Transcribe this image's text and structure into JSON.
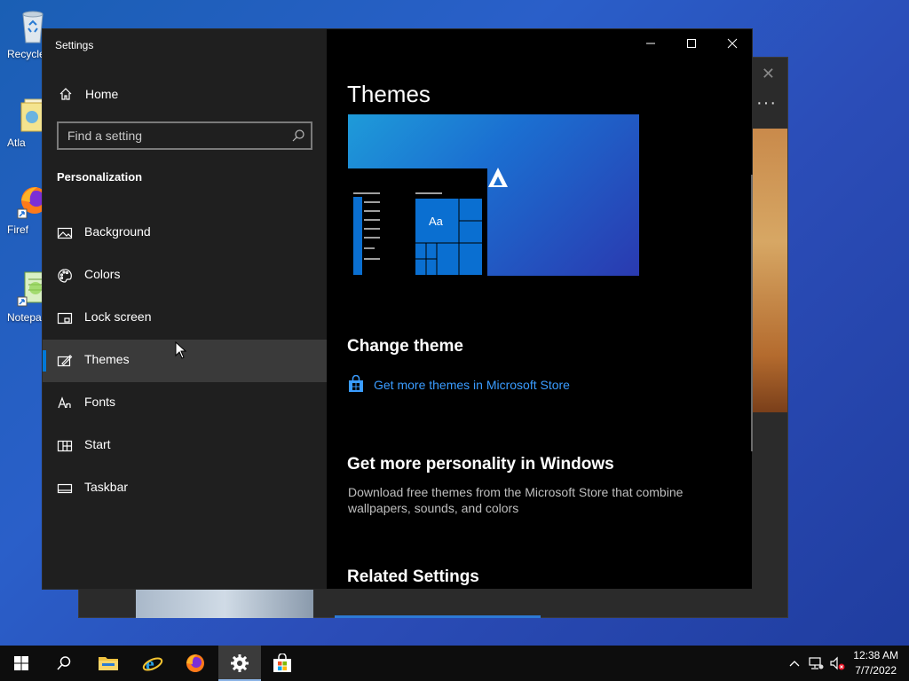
{
  "desktop": {
    "icons": [
      {
        "label": "Recycle",
        "icon": "recycle-bin-icon"
      },
      {
        "label": "Atla",
        "icon": "folder-icon"
      },
      {
        "label": "Firef",
        "icon": "firefox-icon"
      },
      {
        "label": "Notepa",
        "icon": "notepad-icon"
      }
    ]
  },
  "settings": {
    "window_title": "Settings",
    "home_label": "Home",
    "search_placeholder": "Find a setting",
    "section_title": "Personalization",
    "nav": [
      {
        "label": "Background",
        "icon": "picture-icon"
      },
      {
        "label": "Colors",
        "icon": "palette-icon"
      },
      {
        "label": "Lock screen",
        "icon": "lock-screen-icon"
      },
      {
        "label": "Themes",
        "icon": "brush-icon",
        "selected": true
      },
      {
        "label": "Fonts",
        "icon": "font-icon"
      },
      {
        "label": "Start",
        "icon": "start-icon"
      },
      {
        "label": "Taskbar",
        "icon": "taskbar-icon"
      }
    ],
    "content": {
      "page_title": "Themes",
      "preview_sample_text": "Aa",
      "change_theme_heading": "Change theme",
      "store_link": "Get more themes in Microsoft Store",
      "personality_heading": "Get more personality in Windows",
      "personality_desc": "Download free themes from the Microsoft Store that combine wallpapers, sounds, and colors",
      "related_heading": "Related Settings"
    }
  },
  "colors": {
    "accent": "#0078d7",
    "link": "#3a9cff",
    "sidebar_bg": "#1f1f1f",
    "content_bg": "#000000"
  },
  "taskbar": {
    "clock_time": "12:38 AM",
    "clock_date": "7/7/2022",
    "apps": [
      "start-icon",
      "search-icon",
      "file-explorer-icon",
      "internet-explorer-icon",
      "firefox-icon",
      "settings-icon",
      "microsoft-store-icon"
    ],
    "active_app": "settings-icon"
  }
}
